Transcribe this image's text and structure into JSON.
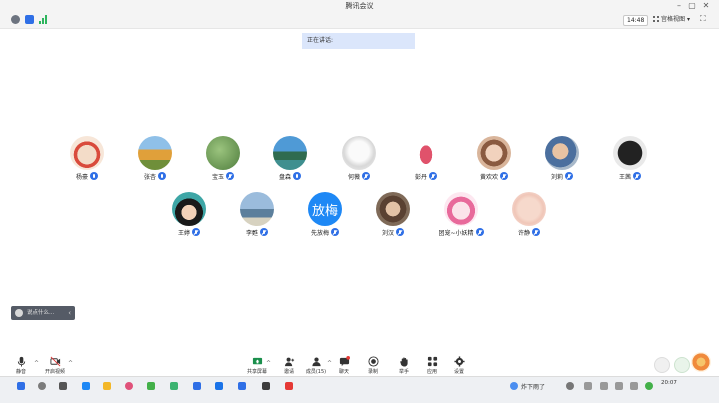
{
  "window": {
    "title": "腾讯会议",
    "controls": [
      "–",
      "▢",
      "✕"
    ]
  },
  "topbar": {
    "time": "14:48",
    "view_label": "宫格视图",
    "view_caret": "▾",
    "fullscreen_glyph": "⛶"
  },
  "speaking": {
    "label": "正在讲话:"
  },
  "participants": [
    {
      "name": "杨豪",
      "mic": "on"
    },
    {
      "name": "张杏",
      "mic": "on"
    },
    {
      "name": "宝玉",
      "mic": "off"
    },
    {
      "name": "盘森",
      "mic": "on"
    },
    {
      "name": "何薇",
      "mic": "off"
    },
    {
      "name": "彭丹",
      "mic": "off"
    },
    {
      "name": "黄欢欢",
      "mic": "off"
    },
    {
      "name": "刘莉",
      "mic": "off"
    },
    {
      "name": "王茜",
      "mic": "off"
    },
    {
      "name": "王婷",
      "mic": "off"
    },
    {
      "name": "李甦",
      "mic": "off"
    },
    {
      "name": "先放梅",
      "mic": "off",
      "avatar_text": "放梅"
    },
    {
      "name": "刘汉",
      "mic": "off"
    },
    {
      "name": "团宠~小妖精",
      "mic": "off"
    },
    {
      "name": "许静",
      "mic": "off"
    }
  ],
  "chat_popup": {
    "text": "说点什么...",
    "arrow": "‹"
  },
  "toolbar": {
    "mute_label": "静音",
    "video_label": "开启视频",
    "share_label": "共享屏幕",
    "invite_label": "邀请",
    "members_label": "成员(15)",
    "chat_label": "聊天",
    "record_label": "录制",
    "raise_hand_label": "举手",
    "apps_label": "应用",
    "settings_label": "设置",
    "caret": "^"
  },
  "taskbar": {
    "status_text": "炸下雨了",
    "clock": "20:07"
  },
  "colors": {
    "accent": "#2f6fe6",
    "banner_bg": "#dbe6fb",
    "chat_bg": "#555b66"
  }
}
